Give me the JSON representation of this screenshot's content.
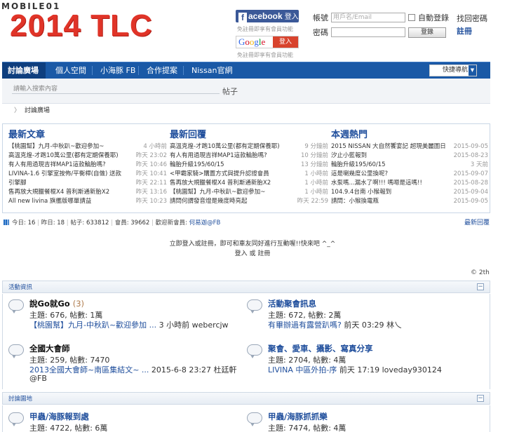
{
  "header": {
    "brand": "MOBILE01",
    "title": "2014 TLC",
    "fb_label": "acebook",
    "fb_login": "登入",
    "social_note": "免註冊即享有會員功能",
    "google_label": [
      "G",
      "o",
      "o",
      "g",
      "l",
      "e"
    ],
    "google_login": "登入",
    "account_label": "帳號",
    "account_placeholder": "用戶名/Email",
    "password_label": "密碼",
    "remember_label": "自動登錄",
    "login_button": "登錄",
    "forgot_link": "找回密碼",
    "register_link": "註冊"
  },
  "nav": {
    "items": [
      "討論廣場",
      "個人空間",
      "小海豚 FB",
      "合作提案",
      "Nissan官網"
    ],
    "quick_nav": "快捷導航"
  },
  "search": {
    "placeholder": "請輸入搜索內容",
    "scope": "帖子"
  },
  "breadcrumb": "討論廣場",
  "latest": {
    "columns": [
      {
        "title": "最新文章",
        "rows": [
          {
            "text": "【桃園幫】九月-中秋趴~歡迎參加~",
            "time": "4 小時前"
          },
          {
            "text": "高溫克煌-才跑10萬公里(都有定期保養耶)",
            "time": "昨天 23:02"
          },
          {
            "text": "有人有用過現吉祥MAP1這款輪胎嗎?",
            "time": "昨天 10:46"
          },
          {
            "text": "LIVINA-1.6 引擎室按佈/平衡桿(自做) 送款",
            "time": "昨天 10:41"
          },
          {
            "text": "引擎腳",
            "time": "昨天 22:11"
          },
          {
            "text": "售再放大規臘餐棍X4 普利斯通新胎X2",
            "time": "昨天 13:16"
          },
          {
            "text": "All new livina 旗艦版哪單請益",
            "time": "昨天 10:23"
          }
        ]
      },
      {
        "title": "最新回覆",
        "rows": [
          {
            "text": "高溫克煌-才跑10萬公里(都有定期保養耶)",
            "time": "9 分鐘前"
          },
          {
            "text": "有人有用過現吉祥MAP1這款輪胎嗎?",
            "time": "10 分鐘前"
          },
          {
            "text": "輪胎升級195/60/15",
            "time": "13 分鐘前"
          },
          {
            "text": "<甲霸家騎>購置方式與提升認證會員",
            "time": "1 小時前"
          },
          {
            "text": "售再放大規臘餐棍X4 普利斯通新胎X2",
            "time": "1 小時前"
          },
          {
            "text": "【桃園幫】九月-中秋趴~歡迎參加~",
            "time": "1 小時前"
          },
          {
            "text": "請問何謂發音燈是幾度時亮起",
            "time": "昨天 22:59"
          }
        ]
      },
      {
        "title": "本週熱門",
        "rows": [
          {
            "text": "2015 NISSAN 大自然饗宴記 超現美麗圖日",
            "time": "2015-09-05"
          },
          {
            "text": "汐止小藍報到",
            "time": "2015-08-23"
          },
          {
            "text": "輪胎升級195/60/15",
            "time": "3 天前"
          },
          {
            "text": "這是喇幾度公里換呢?",
            "time": "2015-09-07"
          },
          {
            "text": "水泵嗎...漏水了啊!!! 嗎嗯是這嗎!!",
            "time": "2015-08-28"
          },
          {
            "text": "104.9.4台南 小猴報到",
            "time": "2015-09-04"
          },
          {
            "text": "請問：小猴換電瓶",
            "time": "2015-09-05"
          }
        ]
      }
    ]
  },
  "stats": {
    "today_label": "今日:",
    "today": "16",
    "yesterday_label": "昨日:",
    "yesterday": "18",
    "posts_label": "帖子:",
    "posts": "633812",
    "members_label": "會員:",
    "members": "39662",
    "newest_label": "歡迎新會員:",
    "newest": "何易迦@FB",
    "latest_reply": "最新回覆"
  },
  "login_prompt": "立即登入或註冊，即可和車友同好進行互動喔!!快來吧 ^_^",
  "login_links": "登入 或 註冊",
  "online_note": "© 2th",
  "sections": [
    {
      "label": "活動資訊",
      "forums": [
        {
          "name": "說Go就Go",
          "count": "(3)",
          "stats": "主題: 676, 帖數: 1萬",
          "last": "【桃園幫】九月-中秋趴~歡迎參加 ...",
          "last_meta": " 3 小時前 webercjw",
          "last2": ""
        },
        {
          "name": "活動聚會訊息",
          "count": "",
          "stats": "主題: 672, 帖數: 2萬",
          "last": "有畢辦過有露營趴嗎?",
          "last_meta": " 前天 03:29 林乀",
          "last2": ""
        },
        {
          "name": "全國大會師",
          "count": "",
          "stats": "主題: 259, 帖數: 7470",
          "last": "2013全國大會師~南區集結文~ ...",
          "last_meta": " 2015-6-8 23:27 杜廷軒",
          "last2": "@FB"
        },
        {
          "name": "聚會、愛車、攝影、寫真分享",
          "count": "",
          "stats": "主題: 2704, 帖數: 4萬",
          "last": "LIVINA 中區外拍-序",
          "last_meta": " 前天 17:19 loveday930124",
          "last2": ""
        }
      ]
    },
    {
      "label": "討論園地",
      "forums": [
        {
          "name": "甲蟲/海豚報到處",
          "count": "",
          "stats": "主題: 4722, 帖數: 6萬",
          "last": "",
          "last_meta": "",
          "last2": ""
        },
        {
          "name": "甲蟲/海豚抓抓樂",
          "count": "",
          "stats": "主題: 7474, 帖數: 4萬",
          "last": "",
          "last_meta": "",
          "last2": ""
        }
      ]
    }
  ]
}
